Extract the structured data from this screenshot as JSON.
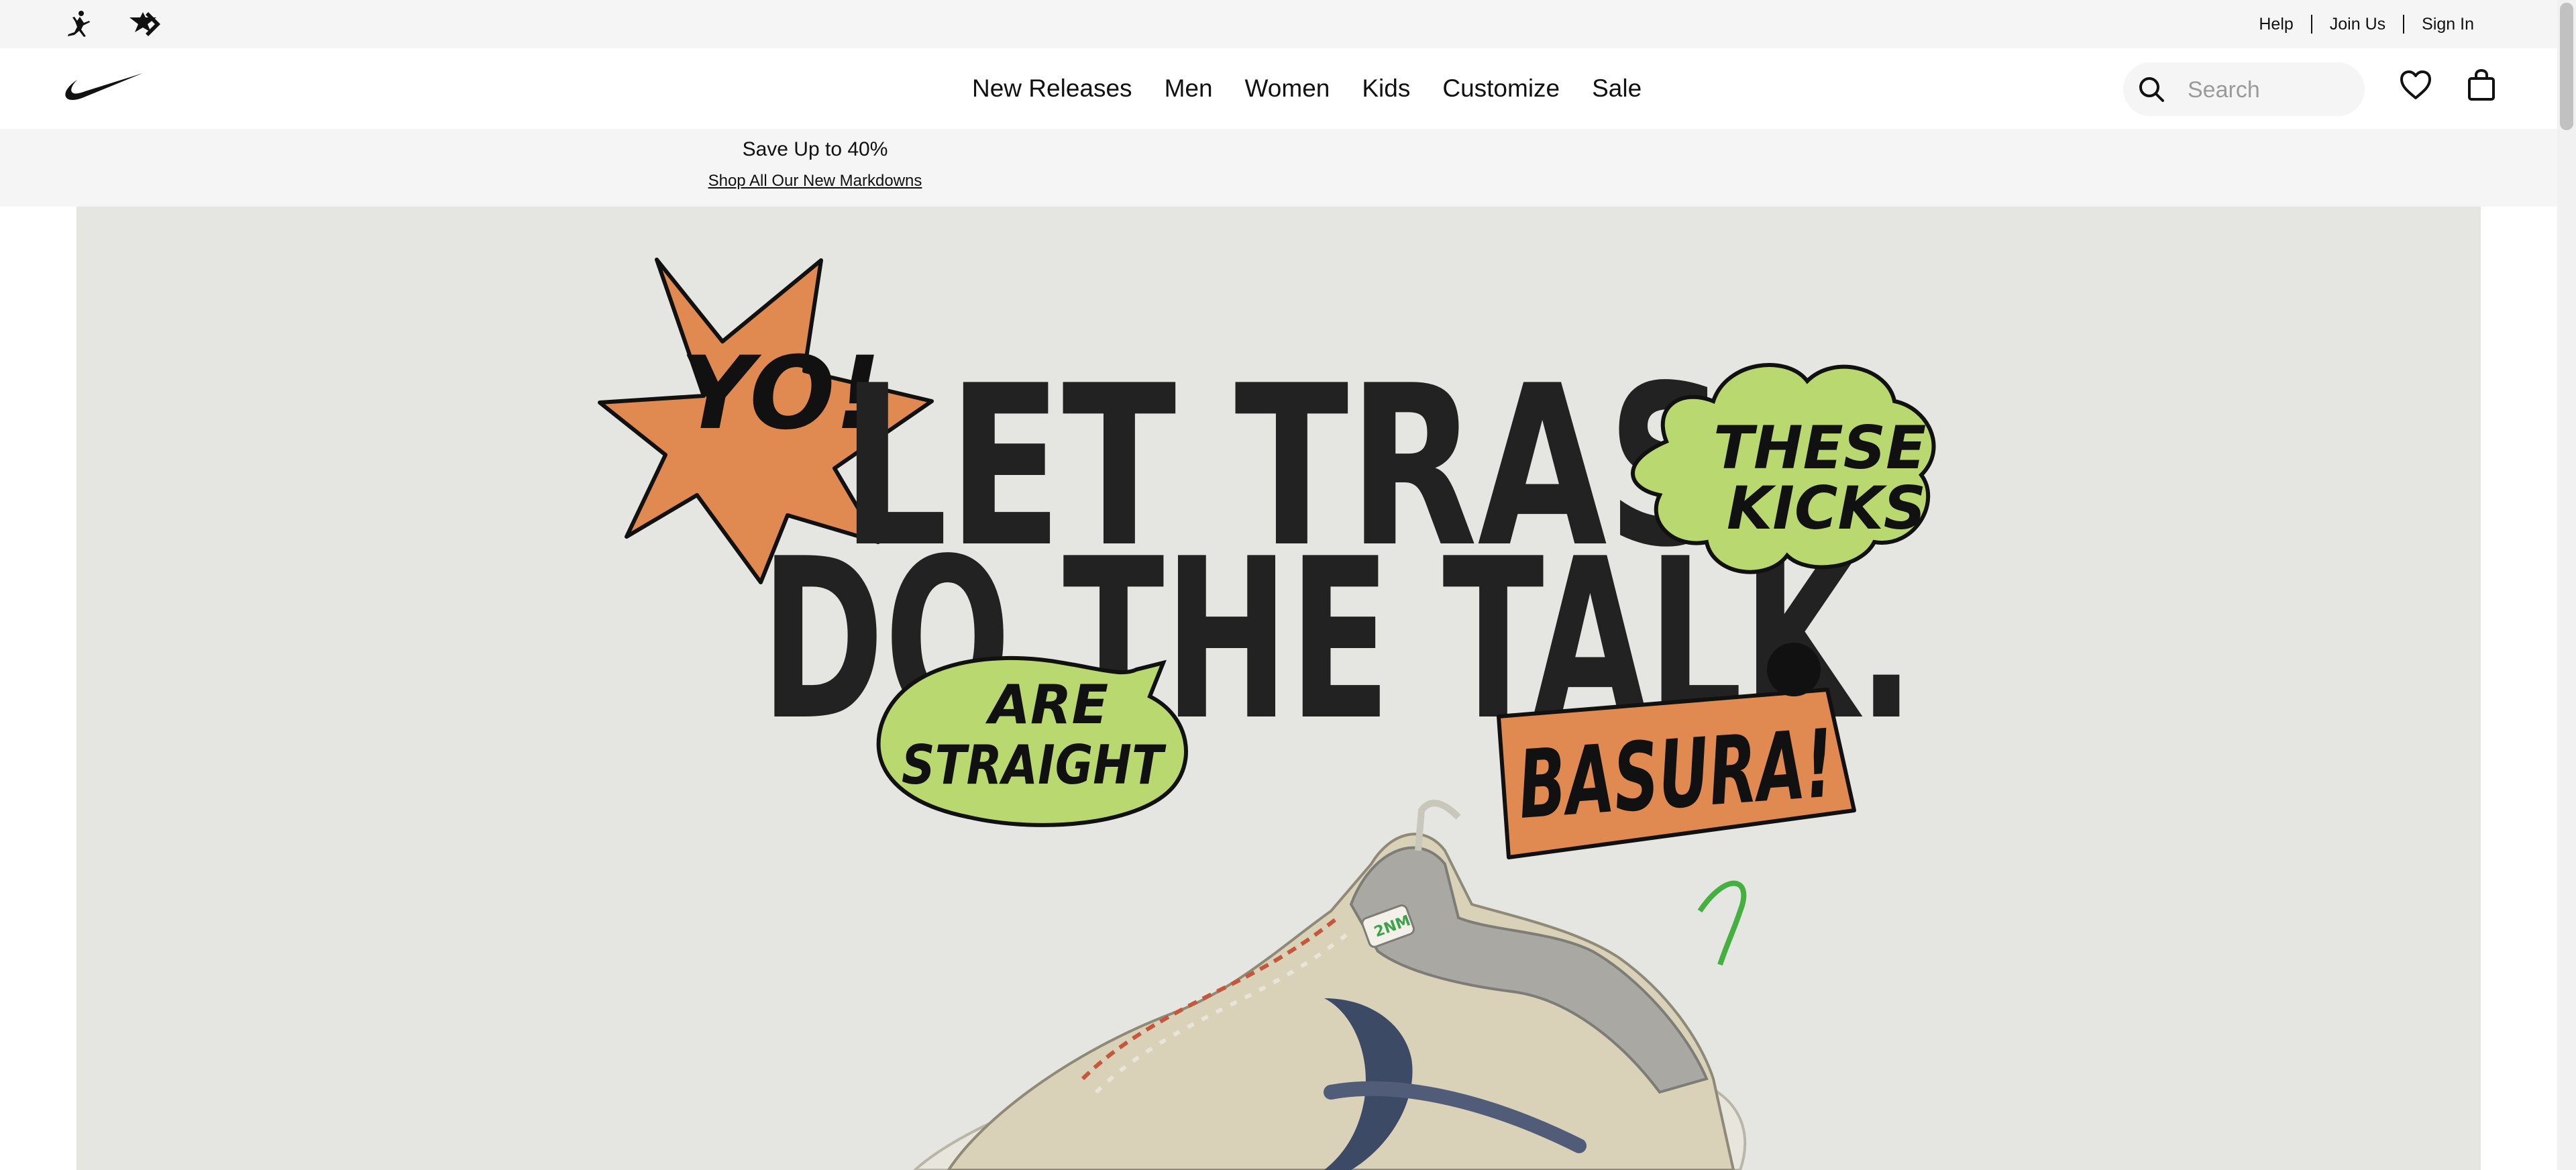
{
  "utility_bar": {
    "brands": [
      "jordan-icon",
      "converse-icon"
    ],
    "links": [
      "Help",
      "Join Us",
      "Sign In"
    ]
  },
  "nav": {
    "logo": "nike-swoosh-icon",
    "items": [
      "New Releases",
      "Men",
      "Women",
      "Kids",
      "Customize",
      "Sale"
    ],
    "search": {
      "placeholder": "Search",
      "value": ""
    }
  },
  "promo": {
    "title": "Save Up to 40%",
    "link": "Shop All Our New Markdowns"
  },
  "hero": {
    "headline_line1": "LET TRASH",
    "headline_line2": "DO THE TALK.",
    "burst_text": "YO!",
    "bubble_top_line1": "THESE",
    "bubble_top_line2": "KICKS",
    "bubble_bottom_line1": "ARE",
    "bubble_bottom_line2": "STRAIGHT",
    "tag_text": "BASURA!",
    "colors": {
      "background": "#e5e5e1",
      "orange": "#e08a52",
      "green": "#b9d870",
      "ink": "#222222"
    }
  }
}
